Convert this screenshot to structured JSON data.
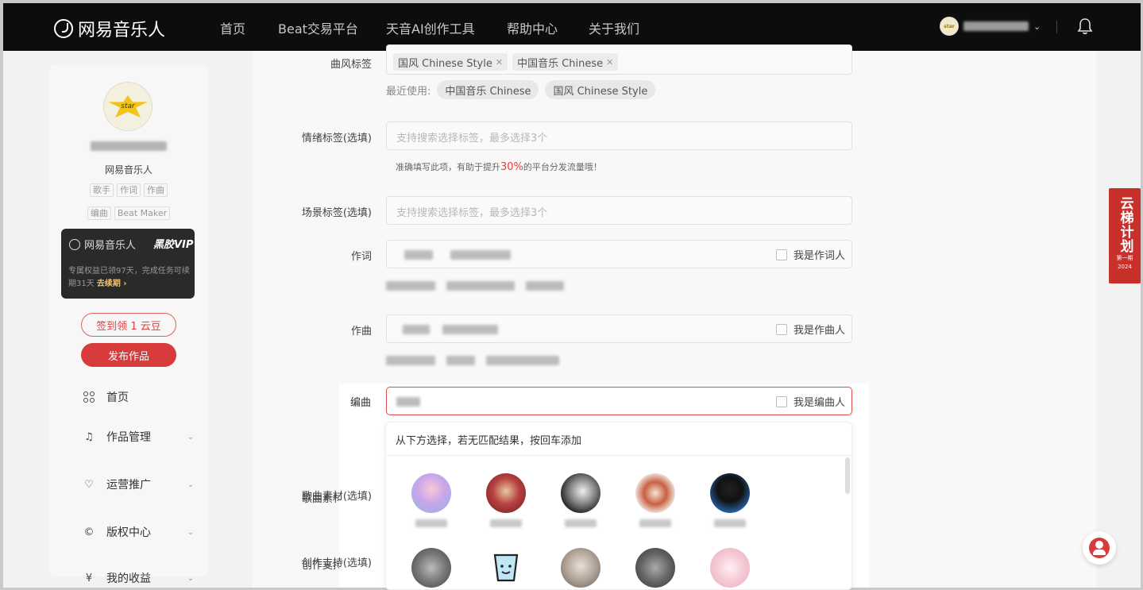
{
  "brand": {
    "name": "网易音乐人"
  },
  "nav": {
    "items": [
      "首页",
      "Beat交易平台",
      "天音AI创作工具",
      "帮助中心",
      "关于我们"
    ],
    "avatar_text": "star"
  },
  "sidebar": {
    "avatar_text": "star",
    "role": "网易音乐人",
    "tags_row1": [
      "歌手",
      "作词",
      "作曲"
    ],
    "tags_row2": [
      "编曲",
      "Beat Maker"
    ],
    "vip": {
      "title": "网易音乐人",
      "badge": "黑胶VIP",
      "desc": "专属权益已领97天，完成任务可续期31天",
      "link": "去续期 ›"
    },
    "checkin_label": "签到领 1 云豆",
    "publish_label": "发布作品",
    "menu": [
      {
        "label": "首页",
        "icon": "grid-icon"
      },
      {
        "label": "作品管理",
        "icon": "music-file-icon"
      },
      {
        "label": "运营推广",
        "icon": "promote-icon"
      },
      {
        "label": "版权中心",
        "icon": "copyright-icon"
      },
      {
        "label": "我的收益",
        "icon": "income-icon"
      }
    ]
  },
  "form": {
    "style_tags": {
      "label": "曲风标签",
      "chips": [
        "国风 Chinese Style",
        "中国音乐 Chinese"
      ],
      "recent_label": "最近使用:",
      "recent": [
        "中国音乐 Chinese",
        "国风 Chinese Style"
      ]
    },
    "mood_tags": {
      "label": "情绪标签(选填)",
      "placeholder": "支持搜索选择标签，最多选择3个",
      "hint_prefix": "准确填写此项，有助于提升",
      "hint_highlight": "30%",
      "hint_suffix": "的平台分发流量哦！"
    },
    "scene_tags": {
      "label": "场景标签(选填)",
      "placeholder": "支持搜索选择标签，最多选择3个"
    },
    "lyricist": {
      "label": "作词",
      "checkbox": "我是作词人"
    },
    "composer": {
      "label": "作曲",
      "checkbox": "我是作曲人"
    },
    "arranger": {
      "label": "编曲",
      "checkbox": "我是编曲人"
    },
    "material": {
      "label": "歌曲素材(选填)"
    },
    "support": {
      "label": "创作支持(选填)"
    }
  },
  "dropdown": {
    "hint": "从下方选择，若无匹配结果，按回车添加"
  },
  "yunti": {
    "title": "云梯计划",
    "sub": "第一期",
    "year": "2024"
  }
}
